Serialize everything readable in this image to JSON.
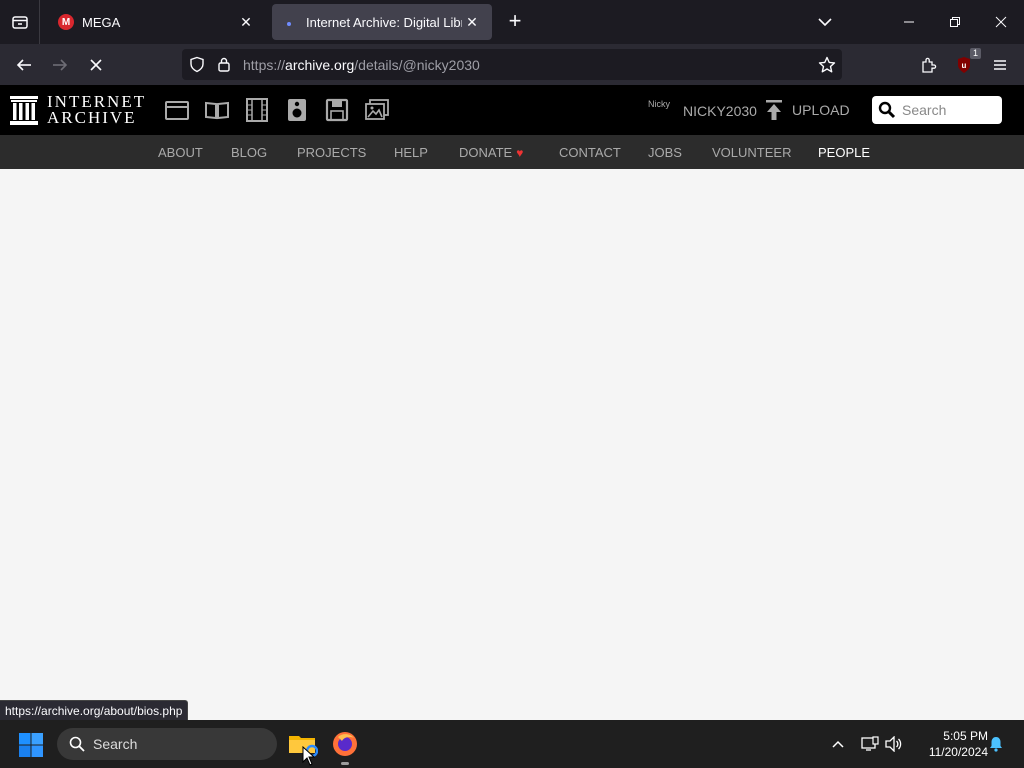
{
  "browser": {
    "tabs": [
      {
        "title": "MEGA",
        "active": false,
        "icon": "mega-icon"
      },
      {
        "title": "Internet Archive: Digital Library",
        "active": true,
        "icon": "loading-icon"
      }
    ],
    "url": {
      "scheme": "https://",
      "host": "archive.org",
      "path": "/details/@nicky2030"
    },
    "extension_badge": "1",
    "status_url": "https://archive.org/about/bios.php"
  },
  "ia": {
    "logo_line1": "INTERNET",
    "logo_line2": "ARCHIVE",
    "media_icons": [
      "web-icon",
      "texts-icon",
      "video-icon",
      "audio-icon",
      "software-icon",
      "images-icon"
    ],
    "user_small": "Nicky",
    "user_name": "NICKY2030",
    "upload_label": "UPLOAD",
    "search_placeholder": "Search",
    "nav": [
      "ABOUT",
      "BLOG",
      "PROJECTS",
      "HELP",
      "DONATE",
      "CONTACT",
      "JOBS",
      "VOLUNTEER",
      "PEOPLE"
    ],
    "active_nav": "PEOPLE"
  },
  "taskbar": {
    "search_label": "Search",
    "time": "5:05 PM",
    "date": "11/20/2024"
  },
  "colors": {
    "accent": "#2a7ae2",
    "donate_heart": "#e33333",
    "header_bg": "#000000",
    "subnav_bg": "#2c2c2c"
  }
}
